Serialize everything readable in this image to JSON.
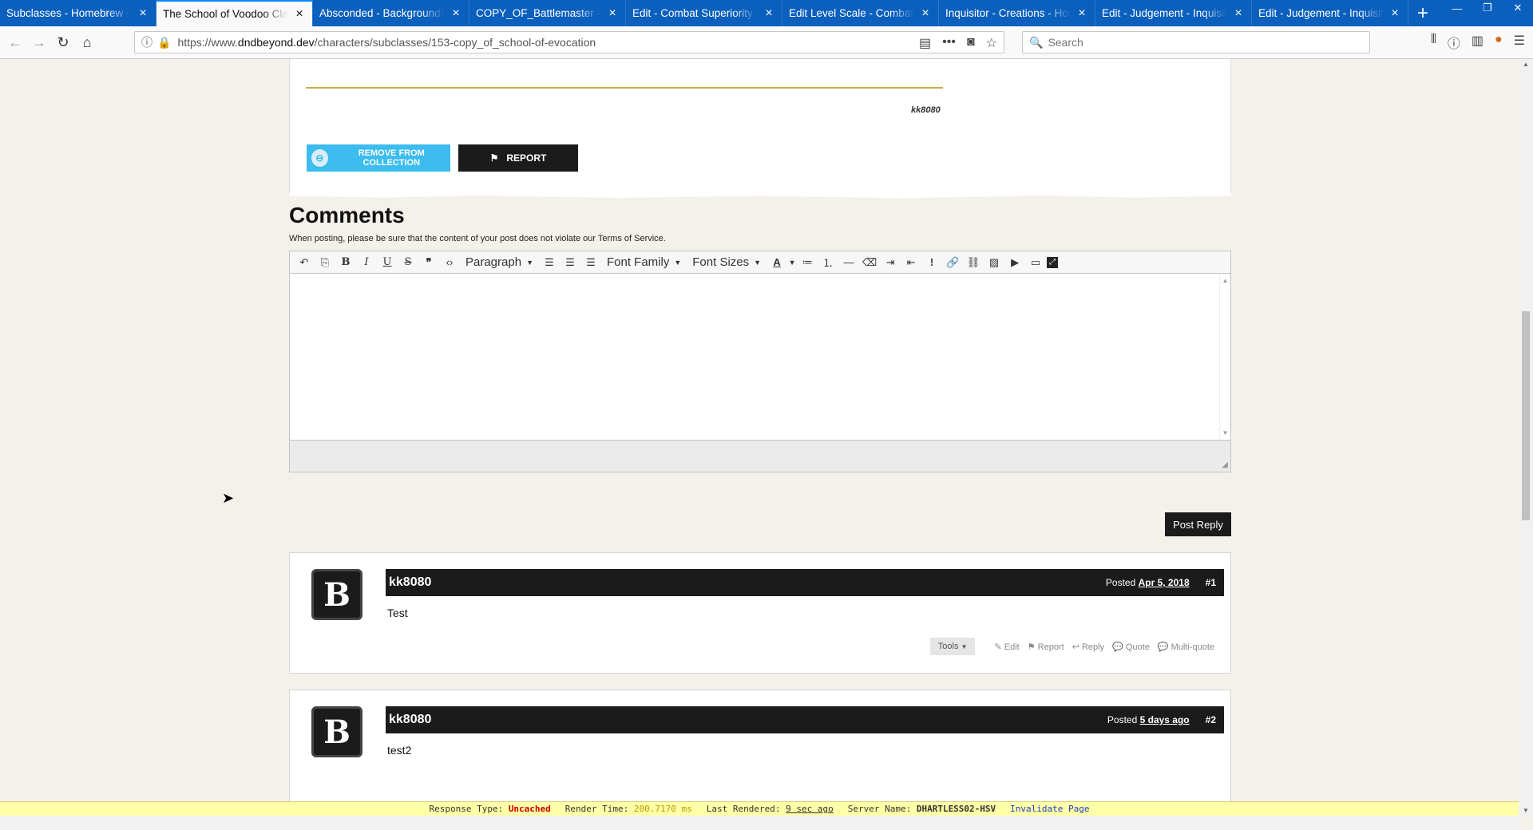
{
  "tabs": [
    {
      "title": "Subclasses - Homebrew - D&D Beyond",
      "active": false
    },
    {
      "title": "The School of Voodoo Class for",
      "active": true
    },
    {
      "title": "Absconded - Backgrounds - D&D",
      "active": false
    },
    {
      "title": "COPY_OF_Battlemaster - Creations",
      "active": false
    },
    {
      "title": "Edit - Combat Superiority - Class",
      "active": false
    },
    {
      "title": "Edit Level Scale - Combat Superiority",
      "active": false
    },
    {
      "title": "Inquisitor - Creations - Homebrew",
      "active": false
    },
    {
      "title": "Edit - Judgement - Inquisitor",
      "active": false
    },
    {
      "title": "Edit - Judgement - Inquisitor",
      "active": false
    }
  ],
  "navbar": {
    "url_prefix": "https://www.",
    "url_host": "dndbeyond.dev",
    "url_path": "/characters/subclasses/153-copy_of_school-of-evocation",
    "search_placeholder": "Search"
  },
  "article": {
    "author": "kk8080",
    "remove_label": "REMOVE FROM COLLECTION",
    "report_label": "REPORT"
  },
  "comments": {
    "title": "Comments",
    "tos_note": "When posting, please be sure that the content of your post does not violate our Terms of Service.",
    "toolbar": {
      "paragraph": "Paragraph",
      "font_family": "Font Family",
      "font_sizes": "Font Sizes"
    },
    "post_reply": "Post Reply",
    "items": [
      {
        "author": "kk8080",
        "posted_label": "Posted",
        "date": "Apr 5, 2018",
        "num": "#1",
        "body": "Test"
      },
      {
        "author": "kk8080",
        "posted_label": "Posted",
        "date": "5 days ago",
        "num": "#2",
        "body": "test2"
      }
    ],
    "actions": {
      "tools": "Tools",
      "edit": "Edit",
      "report": "Report",
      "reply": "Reply",
      "quote": "Quote",
      "multiquote": "Multi-quote"
    }
  },
  "devbar": {
    "response_label": "Response Type:",
    "response_value": "Uncached",
    "render_label": "Render Time:",
    "render_value": "200.7170 ms",
    "rendered_label": "Last Rendered:",
    "rendered_value": "9 sec ago",
    "server_label": "Server Name:",
    "server_value": "DHARTLESS02-HSV",
    "invalidate": "Invalidate Page"
  },
  "colors": {
    "tab_strip": "#0b5fbd",
    "remove_button": "#3cbcef",
    "dark": "#1b1b1b",
    "gold_rule": "#c9a94c",
    "devbar": "#ffffa8"
  }
}
